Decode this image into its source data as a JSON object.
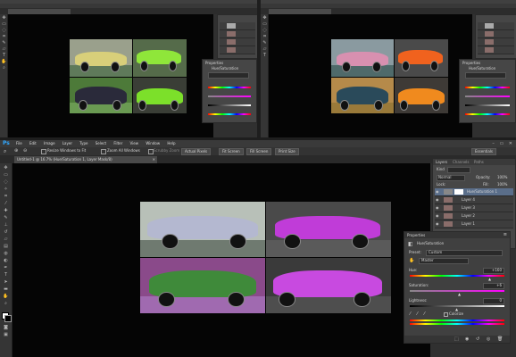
{
  "main": {
    "app_logo": "Ps",
    "menu": [
      "File",
      "Edit",
      "Image",
      "Layer",
      "Type",
      "Select",
      "Filter",
      "View",
      "Window",
      "Help"
    ],
    "options": {
      "resize_windows": "Resize Windows to Fit",
      "zoom_all": "Zoom All Windows",
      "scrubby": "Scrubby Zoom",
      "actual_pixels": "Actual Pixels",
      "fit_screen": "Fit Screen",
      "fill_screen": "Fill Screen",
      "print_size": "Print Size",
      "workspace": "Essentials"
    },
    "doc_tab": "Untitled-1 @ 16.7% (Hue/Saturation 1, Layer Mask/8)",
    "layers_panel": {
      "tabs": [
        "Layers",
        "Channels",
        "Paths"
      ],
      "kind_label": "Kind",
      "blend_mode": "Normal",
      "opacity_label": "Opacity:",
      "opacity_value": "100%",
      "fill_label": "Fill:",
      "fill_value": "100%",
      "lock_label": "Lock:",
      "layers": [
        "Hue/Saturation 1",
        "Layer 4",
        "Layer 3",
        "Layer 2",
        "Layer 1"
      ]
    },
    "properties_panel": {
      "title": "Properties",
      "subtitle": "Hue/Saturation",
      "preset_label": "Preset:",
      "preset_value": "Custom",
      "channel_value": "Master",
      "hue_label": "Hue:",
      "hue_value": "+160",
      "saturation_label": "Saturation:",
      "saturation_value": "+6",
      "lightness_label": "Lightness:",
      "lightness_value": "0",
      "colorize_label": "Colorize"
    }
  },
  "top_left_window": {
    "panel_title": "Properties",
    "subtitle": "Hue/Saturation"
  },
  "top_right_window": {
    "panel_title": "Properties",
    "subtitle": "Hue/Saturation"
  },
  "colors": {
    "workspace": "#303030",
    "canvas": "#050505",
    "magenta_car": "#c03cd8",
    "green_car": "#6fd22a",
    "orange_car": "#f08a1e",
    "green_tint": "#3f8a3a"
  }
}
